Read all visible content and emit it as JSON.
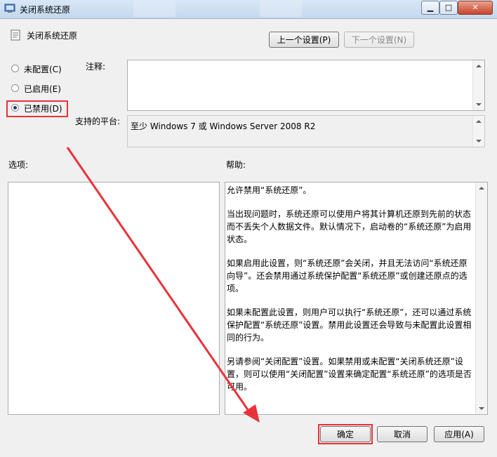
{
  "window": {
    "title": "关闭系统还原",
    "controls": {
      "minimize": "▁",
      "maximize": "□",
      "close": "✕"
    }
  },
  "header": {
    "policy_name": "关闭系统还原",
    "prev_button": "上一个设置(P)",
    "next_button": "下一个设置(N)"
  },
  "state_options": [
    {
      "label": "未配置(C)",
      "checked": false
    },
    {
      "label": "已启用(E)",
      "checked": false
    },
    {
      "label": "已禁用(D)",
      "checked": true
    }
  ],
  "comment": {
    "label": "注释:",
    "value": ""
  },
  "platform": {
    "label": "支持的平台:",
    "value": "至少 Windows 7 或 Windows Server 2008 R2"
  },
  "options_label": "选项:",
  "help": {
    "label": "帮助:",
    "paragraphs": [
      "允许禁用“系统还原”。",
      "当出现问题时，系统还原可以使用户将其计算机还原到先前的状态而不丢失个人数据文件。默认情况下，启动卷的“系统还原”为启用状态。",
      "如果启用此设置，则“系统还原”会关闭，并且无法访问“系统还原向导”。还会禁用通过系统保护配置“系统还原”或创建还原点的选项。",
      "如果未配置此设置，则用户可以执行“系统还原”，还可以通过系统保护配置“系统还原”设置。禁用此设置还会导致与未配置此设置相同的行为。",
      "另请参阅“关闭配置”设置。如果禁用或未配置“关闭系统还原”设置，则可以使用“关闭配置”设置来确定配置“系统还原”的选项是否可用。"
    ]
  },
  "footer": {
    "ok": "确定",
    "cancel": "取消",
    "apply": "应用(A)"
  },
  "annotation": {
    "color": "#e8323a"
  }
}
